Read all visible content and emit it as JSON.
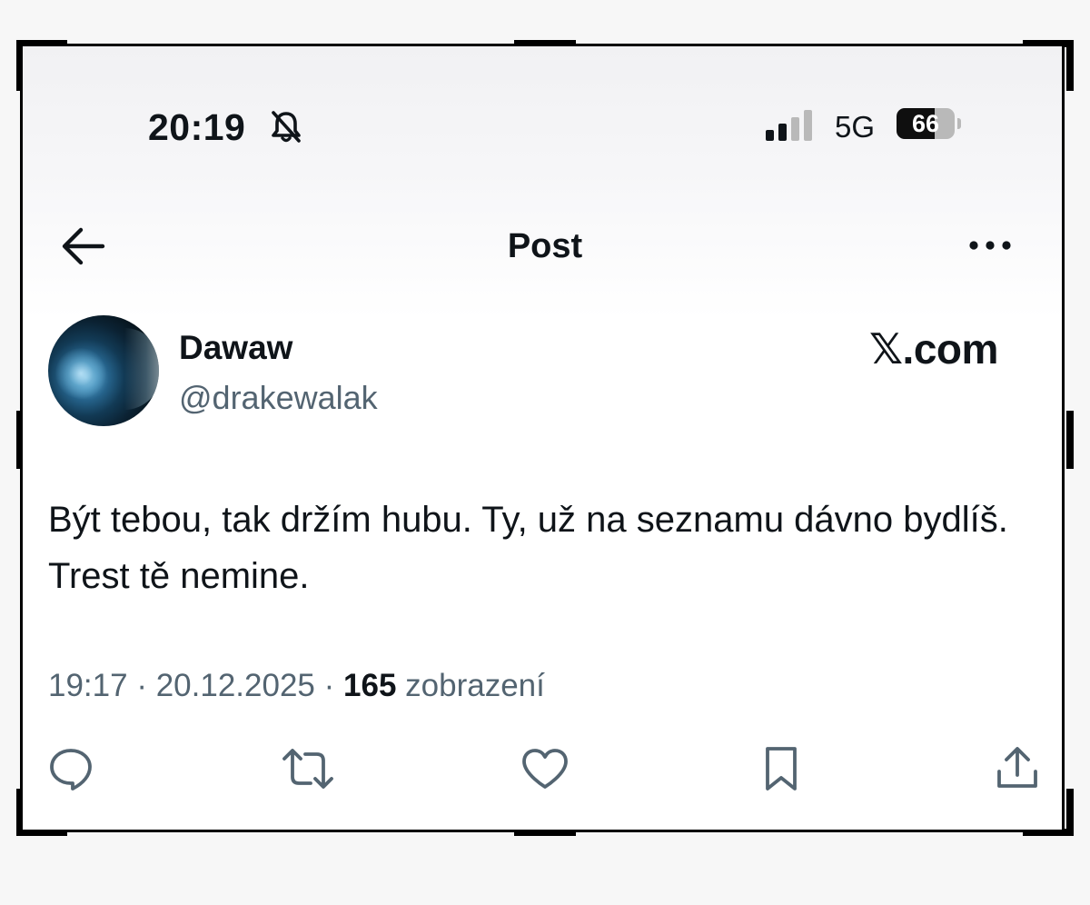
{
  "status_bar": {
    "time": "20:19",
    "network": "5G",
    "battery": "66",
    "icons": [
      "bell-slash-icon",
      "signal-icon"
    ]
  },
  "header": {
    "title": "Post",
    "back_icon": "arrow-left-icon",
    "more_icon": "more-horizontal-icon"
  },
  "author": {
    "display_name": "Dawaw",
    "handle": "@drakewalak"
  },
  "brand": "𝕏.com",
  "post": {
    "text": "Být tebou, tak držím hubu. Ty, už na seznamu dávno bydlíš. Trest tě nemine.",
    "time": "19:17",
    "separator": "·",
    "date": "20.12.2025",
    "views": "165",
    "views_label": "zobrazení"
  },
  "actions": [
    {
      "icon": "reply-icon"
    },
    {
      "icon": "repost-icon"
    },
    {
      "icon": "like-icon"
    },
    {
      "icon": "bookmark-icon"
    },
    {
      "icon": "share-icon"
    }
  ],
  "colors": {
    "text": "#0f1419",
    "secondary": "#536471",
    "icon": "#536471",
    "frame": "#000000"
  }
}
